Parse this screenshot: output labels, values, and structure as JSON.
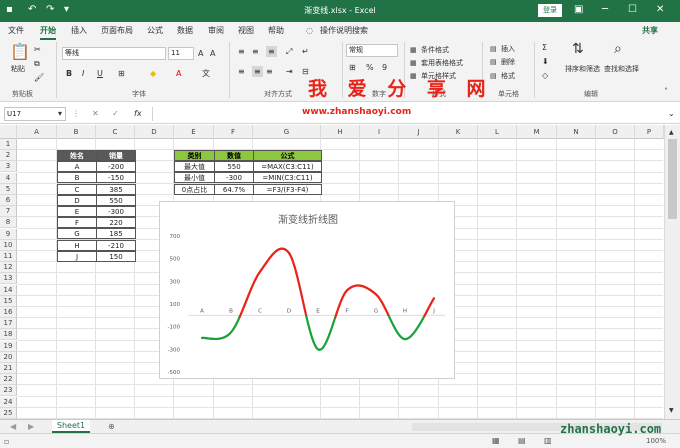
{
  "titlebar": {
    "title": "渐变线.xlsx - Excel",
    "login": "登录"
  },
  "menu": {
    "tabs": [
      "文件",
      "开始",
      "插入",
      "页面布局",
      "公式",
      "数据",
      "审阅",
      "视图",
      "帮助"
    ],
    "tell_me": "操作说明搜索",
    "share": "共享"
  },
  "ribbon": {
    "paste": "粘贴",
    "clipboard": "剪贴板",
    "font_name": "等线",
    "font_size": "11",
    "font_group": "字体",
    "align_group": "对齐方式",
    "number_format": "常规",
    "number_group": "数字",
    "cond_format": "条件格式",
    "table_format": "套用表格格式",
    "cell_style": "单元格样式",
    "style_group": "样式",
    "insert": "插入",
    "delete": "删除",
    "format": "格式",
    "cells_group": "单元格",
    "sort": "排序和筛选",
    "find": "查找和选择",
    "edit_group": "编辑"
  },
  "watermark": "我 爱 分 享 网",
  "formula_bar": {
    "name_box": "U17",
    "fx": "fx"
  },
  "watermark_url": "www.zhanshaoyi.com",
  "columns": [
    "A",
    "B",
    "C",
    "D",
    "E",
    "F",
    "G",
    "H",
    "I",
    "J",
    "K",
    "L",
    "M",
    "N",
    "O",
    "P"
  ],
  "rows": [
    "1",
    "2",
    "3",
    "4",
    "5",
    "6",
    "7",
    "8",
    "9",
    "10",
    "11",
    "12",
    "13",
    "14",
    "15",
    "16",
    "17",
    "18",
    "19",
    "20",
    "21",
    "22",
    "23",
    "24",
    "25"
  ],
  "table1": {
    "headers": [
      "姓名",
      "销量"
    ],
    "rows": [
      [
        "A",
        "-200"
      ],
      [
        "B",
        "-150"
      ],
      [
        "C",
        "385"
      ],
      [
        "D",
        "550"
      ],
      [
        "E",
        "-300"
      ],
      [
        "F",
        "220"
      ],
      [
        "G",
        "185"
      ],
      [
        "H",
        "-210"
      ],
      [
        "J",
        "150"
      ]
    ]
  },
  "table2": {
    "headers": [
      "类别",
      "数值",
      "公式"
    ],
    "rows": [
      [
        "最大值",
        "550",
        "=MAX(C3:C11)"
      ],
      [
        "最小值",
        "-300",
        "=MIN(C3:C11)"
      ],
      [
        "0点占比",
        "64.7%",
        "=F3/(F3-F4)"
      ]
    ]
  },
  "chart_data": {
    "type": "line",
    "title": "渐变线折线图",
    "categories": [
      "A",
      "B",
      "C",
      "D",
      "E",
      "F",
      "G",
      "H",
      "J"
    ],
    "values": [
      -200,
      -150,
      385,
      550,
      -300,
      220,
      185,
      -210,
      150
    ],
    "ylim": [
      -500,
      700
    ],
    "yticks": [
      "700",
      "500",
      "300",
      "100",
      "-100",
      "-300",
      "-500"
    ],
    "colors": {
      "positive": "#e8241a",
      "negative": "#1aa33a"
    }
  },
  "sheets": {
    "active": "Sheet1"
  },
  "status": {
    "zoom": "100%"
  },
  "watermark2": "zhanshaoyi.com",
  "colors": {
    "excel_green": "#217346"
  }
}
